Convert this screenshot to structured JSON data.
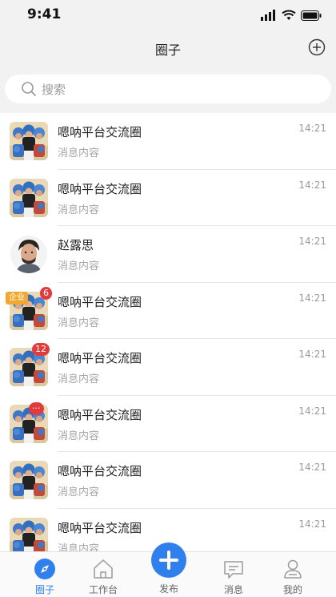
{
  "status": {
    "time": "9:41"
  },
  "nav": {
    "title": "圈子"
  },
  "search": {
    "placeholder": "搜索"
  },
  "list": [
    {
      "name": "嗯呐平台交流圈",
      "msg": "消息内容",
      "time": "14:21",
      "avatar": "group-avatar"
    },
    {
      "name": "嗯呐平台交流圈",
      "msg": "消息内容",
      "time": "14:21",
      "avatar": "group-avatar"
    },
    {
      "name": "赵露思",
      "msg": "消息内容",
      "time": "14:21",
      "avatar": "person-avatar"
    },
    {
      "name": "嗯呐平台交流圈",
      "msg": "消息内容",
      "time": "14:21",
      "avatar": "group-avatar",
      "tag": "企业",
      "badge": "6"
    },
    {
      "name": "嗯呐平台交流圈",
      "msg": "消息内容",
      "time": "14:21",
      "avatar": "group-avatar",
      "badge": "12"
    },
    {
      "name": "嗯呐平台交流圈",
      "msg": "消息内容",
      "time": "14:21",
      "avatar": "group-avatar",
      "badge": "···"
    },
    {
      "name": "嗯呐平台交流圈",
      "msg": "消息内容",
      "time": "14:21",
      "avatar": "group-avatar"
    },
    {
      "name": "嗯呐平台交流圈",
      "msg": "消息内容",
      "time": "14:21",
      "avatar": "group-avatar"
    }
  ],
  "tabs": [
    {
      "label": "圈子",
      "icon": "compass-icon",
      "active": true
    },
    {
      "label": "工作台",
      "icon": "home-icon",
      "active": false
    },
    {
      "label": "发布",
      "icon": "plus-icon",
      "active": false
    },
    {
      "label": "消息",
      "icon": "message-icon",
      "active": false
    },
    {
      "label": "我的",
      "icon": "profile-icon",
      "active": false
    }
  ],
  "colors": {
    "accent": "#2f80ed",
    "badge": "#e23b3b",
    "tag": "#f0a830"
  }
}
